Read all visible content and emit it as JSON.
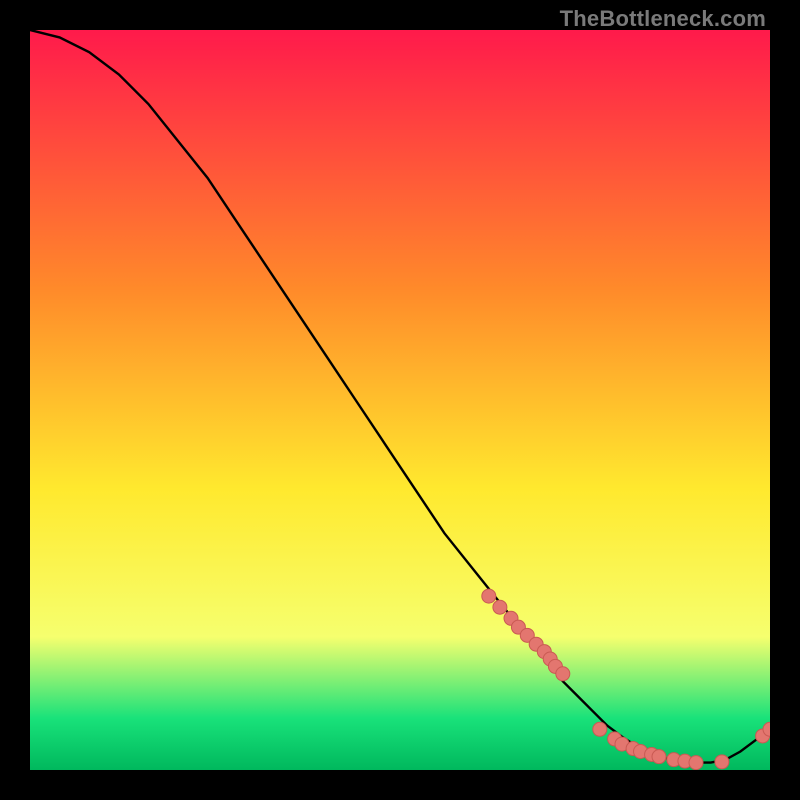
{
  "watermark": "TheBottleneck.com",
  "colors": {
    "background_black": "#000000",
    "gradient_top": "#ff1a4b",
    "gradient_mid_orange": "#ff8a2a",
    "gradient_yellow": "#ffe92e",
    "gradient_light_yellow": "#f6ff6e",
    "gradient_green": "#19e27a",
    "gradient_deep_green": "#00b85d",
    "line": "#000000",
    "marker_fill": "#e3766f",
    "marker_stroke": "#c95a53",
    "watermark": "#7a7a7a"
  },
  "chart_data": {
    "type": "line",
    "title": "",
    "xlabel": "",
    "ylabel": "",
    "xlim": [
      0,
      100
    ],
    "ylim": [
      0,
      100
    ],
    "series": [
      {
        "name": "bottleneck-curve",
        "x": [
          0,
          4,
          8,
          12,
          16,
          20,
          24,
          28,
          32,
          36,
          40,
          44,
          48,
          52,
          56,
          60,
          64,
          68,
          72,
          74,
          76,
          78,
          80,
          82,
          84,
          86,
          88,
          90,
          92,
          94,
          96,
          98,
          100
        ],
        "y": [
          100,
          99,
          97,
          94,
          90,
          85,
          80,
          74,
          68,
          62,
          56,
          50,
          44,
          38,
          32,
          27,
          22,
          17,
          12,
          10,
          8,
          6,
          4.5,
          3.2,
          2.3,
          1.6,
          1.2,
          1.0,
          1.0,
          1.4,
          2.5,
          4.0,
          5.5
        ]
      }
    ],
    "markers": {
      "name": "highlighted-points",
      "x": [
        62,
        63.5,
        65,
        66,
        67.2,
        68.4,
        69.5,
        70.3,
        71,
        72,
        77,
        79,
        80,
        81.5,
        82.5,
        84,
        85,
        87,
        88.5,
        90,
        93.5,
        99,
        100
      ],
      "y": [
        23.5,
        22,
        20.5,
        19.3,
        18.2,
        17,
        16,
        15,
        14,
        13,
        5.5,
        4.2,
        3.5,
        2.9,
        2.5,
        2.1,
        1.8,
        1.4,
        1.2,
        1.0,
        1.1,
        4.6,
        5.5
      ]
    },
    "gradient_stops": [
      {
        "offset": 0.0,
        "key": "gradient_top"
      },
      {
        "offset": 0.35,
        "key": "gradient_mid_orange"
      },
      {
        "offset": 0.62,
        "key": "gradient_yellow"
      },
      {
        "offset": 0.82,
        "key": "gradient_light_yellow"
      },
      {
        "offset": 0.93,
        "key": "gradient_green"
      },
      {
        "offset": 1.0,
        "key": "gradient_deep_green"
      }
    ]
  }
}
